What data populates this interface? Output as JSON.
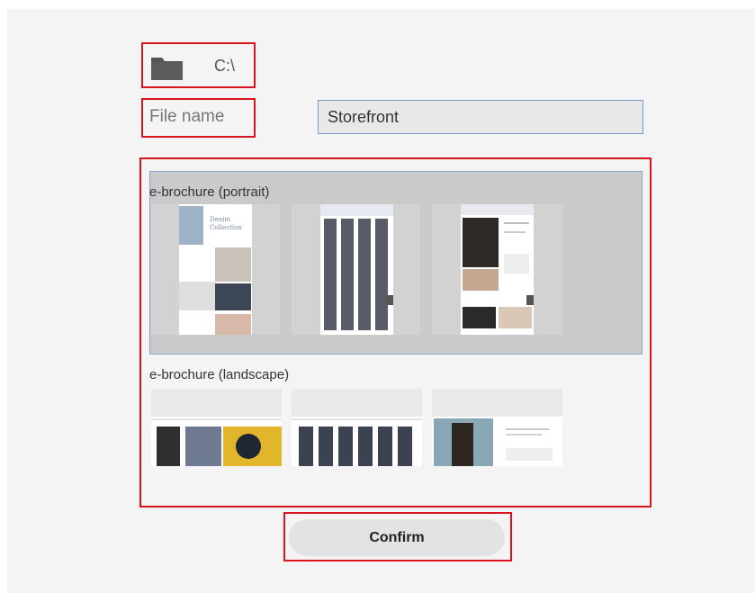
{
  "path": {
    "icon": "folder-icon",
    "value": "C:\\"
  },
  "file_name": {
    "label": "File name",
    "value": "Storefront"
  },
  "templates": {
    "portrait": {
      "label": "e-brochure (portrait)",
      "thumb1_title": "Denim Collection"
    },
    "landscape": {
      "label": "e-brochure (landscape)"
    }
  },
  "actions": {
    "confirm": "Confirm"
  },
  "colors": {
    "highlight": "#d9141f",
    "selection_border": "#8aa3cf",
    "panel_bg": "#f4f4f4"
  }
}
